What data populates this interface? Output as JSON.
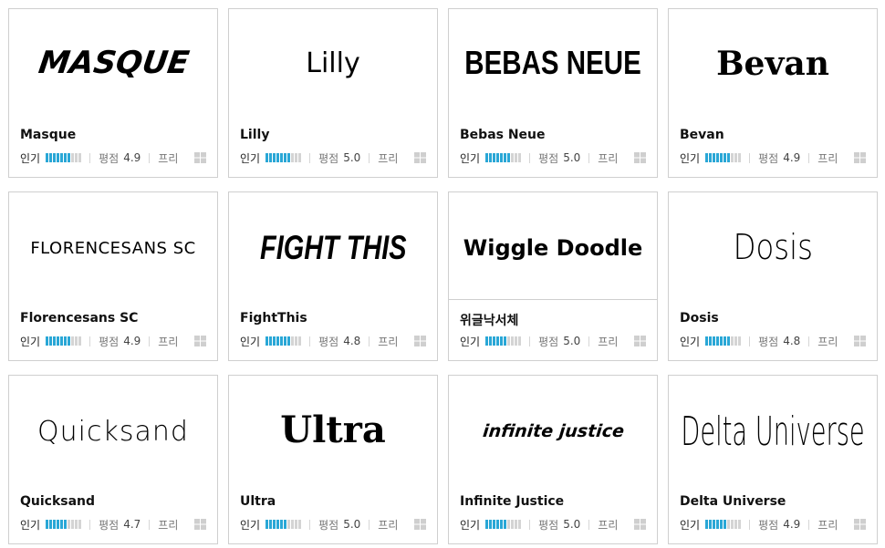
{
  "cards": [
    {
      "name": "Masque",
      "preview": "MASQUE",
      "popularity": 0.7,
      "rating_label": "평점",
      "rating": "4.9",
      "license": "프리",
      "popularity_label": "인기"
    },
    {
      "name": "Lilly",
      "preview": "Lilly",
      "popularity": 0.7,
      "rating_label": "평점",
      "rating": "5.0",
      "license": "프리",
      "popularity_label": "인기"
    },
    {
      "name": "Bebas Neue",
      "preview": "BEBAS NEUE",
      "popularity": 0.7,
      "rating_label": "평점",
      "rating": "5.0",
      "license": "프리",
      "popularity_label": "인기"
    },
    {
      "name": "Bevan",
      "preview": "Bevan",
      "popularity": 0.7,
      "rating_label": "평점",
      "rating": "4.9",
      "license": "프리",
      "popularity_label": "인기"
    },
    {
      "name": "Florencesans SC",
      "preview": "FLORENCESANS SC",
      "popularity": 0.7,
      "rating_label": "평점",
      "rating": "4.9",
      "license": "프리",
      "popularity_label": "인기"
    },
    {
      "name": "FightThis",
      "preview": "FIGHT THIS",
      "popularity": 0.7,
      "rating_label": "평점",
      "rating": "4.8",
      "license": "프리",
      "popularity_label": "인기"
    },
    {
      "name": "위글낙서체",
      "preview": "Wiggle Doodle",
      "popularity": 0.6,
      "rating_label": "평점",
      "rating": "5.0",
      "license": "프리",
      "popularity_label": "인기"
    },
    {
      "name": "Dosis",
      "preview": "Dosis",
      "popularity": 0.7,
      "rating_label": "평점",
      "rating": "4.8",
      "license": "프리",
      "popularity_label": "인기"
    },
    {
      "name": "Quicksand",
      "preview": "Quicksand",
      "popularity": 0.6,
      "rating_label": "평점",
      "rating": "4.7",
      "license": "프리",
      "popularity_label": "인기"
    },
    {
      "name": "Ultra",
      "preview": "Ultra",
      "popularity": 0.6,
      "rating_label": "평점",
      "rating": "5.0",
      "license": "프리",
      "popularity_label": "인기"
    },
    {
      "name": "Infinite Justice",
      "preview": "infinite justice",
      "popularity": 0.6,
      "rating_label": "평점",
      "rating": "5.0",
      "license": "프리",
      "popularity_label": "인기"
    },
    {
      "name": "Delta Universe",
      "preview": "Delta Universe",
      "popularity": 0.6,
      "rating_label": "평점",
      "rating": "4.9",
      "license": "프리",
      "popularity_label": "인기"
    }
  ],
  "icons": {
    "platform": "windows-icon"
  },
  "colors": {
    "bar_on": "#2aa7d6",
    "bar_off": "#d4d4d4",
    "border": "#cfcfcf"
  }
}
